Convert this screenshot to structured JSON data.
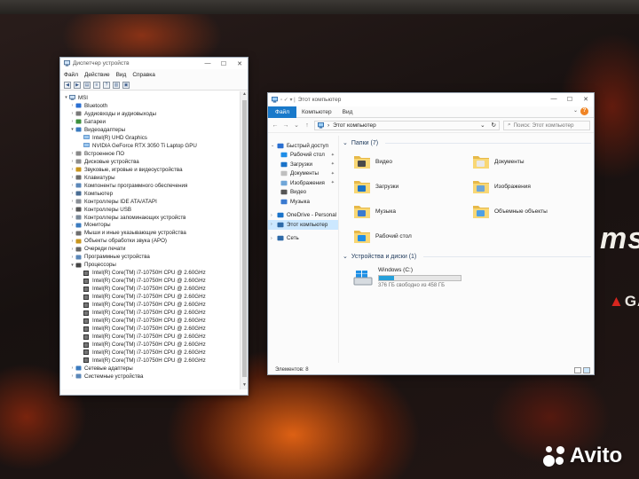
{
  "wallpaper": {
    "brand_text": "msi",
    "gaming_text": "GAM",
    "gaming_accent": "#d7261e",
    "watermark": "Avito"
  },
  "device_manager": {
    "title": "Диспетчер устройств",
    "menu": [
      "Файл",
      "Действие",
      "Вид",
      "Справка"
    ],
    "root": "MSI",
    "categories": [
      {
        "label": "Bluetooth",
        "icon": "bluetooth-icon",
        "expanded": false
      },
      {
        "label": "Аудиовходы и аудиовыходы",
        "icon": "speaker-icon",
        "expanded": false
      },
      {
        "label": "Батареи",
        "icon": "battery-icon",
        "expanded": false
      },
      {
        "label": "Видеоадаптеры",
        "icon": "display-adapter-icon",
        "expanded": true,
        "children": [
          "Intel(R) UHD Graphics",
          "NVIDIA GeForce RTX 3050 Ti Laptop GPU"
        ]
      },
      {
        "label": "Встроенное ПО",
        "icon": "firmware-icon",
        "expanded": false
      },
      {
        "label": "Дисковые устройства",
        "icon": "disk-icon",
        "expanded": false
      },
      {
        "label": "Звуковые, игровые и видеоустройства",
        "icon": "sound-icon",
        "expanded": false
      },
      {
        "label": "Клавиатуры",
        "icon": "keyboard-icon",
        "expanded": false
      },
      {
        "label": "Компоненты программного обеспечения",
        "icon": "software-icon",
        "expanded": false
      },
      {
        "label": "Компьютер",
        "icon": "computer-icon",
        "expanded": false
      },
      {
        "label": "Контроллеры IDE ATA/ATAPI",
        "icon": "ide-icon",
        "expanded": false
      },
      {
        "label": "Контроллеры USB",
        "icon": "usb-icon",
        "expanded": false
      },
      {
        "label": "Контроллеры запоминающих устройств",
        "icon": "storage-icon",
        "expanded": false
      },
      {
        "label": "Мониторы",
        "icon": "monitor-icon",
        "expanded": false
      },
      {
        "label": "Мыши и иные указывающие устройства",
        "icon": "mouse-icon",
        "expanded": false
      },
      {
        "label": "Объекты обработки звука (APO)",
        "icon": "apo-icon",
        "expanded": false
      },
      {
        "label": "Очереди печати",
        "icon": "printer-icon",
        "expanded": false
      },
      {
        "label": "Программные устройства",
        "icon": "software-device-icon",
        "expanded": false
      },
      {
        "label": "Процессоры",
        "icon": "processor-icon",
        "expanded": true,
        "children": [
          "Intel(R) Core(TM) i7-10750H CPU @ 2.60GHz",
          "Intel(R) Core(TM) i7-10750H CPU @ 2.60GHz",
          "Intel(R) Core(TM) i7-10750H CPU @ 2.60GHz",
          "Intel(R) Core(TM) i7-10750H CPU @ 2.60GHz",
          "Intel(R) Core(TM) i7-10750H CPU @ 2.60GHz",
          "Intel(R) Core(TM) i7-10750H CPU @ 2.60GHz",
          "Intel(R) Core(TM) i7-10750H CPU @ 2.60GHz",
          "Intel(R) Core(TM) i7-10750H CPU @ 2.60GHz",
          "Intel(R) Core(TM) i7-10750H CPU @ 2.60GHz",
          "Intel(R) Core(TM) i7-10750H CPU @ 2.60GHz",
          "Intel(R) Core(TM) i7-10750H CPU @ 2.60GHz",
          "Intel(R) Core(TM) i7-10750H CPU @ 2.60GHz"
        ]
      },
      {
        "label": "Сетевые адаптеры",
        "icon": "network-adapter-icon",
        "expanded": false
      },
      {
        "label": "Системные устройства",
        "icon": "system-device-icon",
        "expanded": false
      }
    ]
  },
  "explorer": {
    "title": "Этот компьютер",
    "tabs": [
      "Файл",
      "Компьютер",
      "Вид"
    ],
    "address": "Этот компьютер",
    "search_placeholder": "Поиск: Этот компьютер",
    "nav": [
      {
        "label": "Быстрый доступ",
        "icon": "star-icon",
        "pinned": false,
        "selected": false,
        "indent": 0,
        "expand": "v"
      },
      {
        "label": "Рабочий стол",
        "icon": "desktop-icon",
        "pinned": true,
        "selected": false,
        "indent": 1,
        "expand": ""
      },
      {
        "label": "Загрузки",
        "icon": "download-icon",
        "pinned": true,
        "selected": false,
        "indent": 1,
        "expand": ""
      },
      {
        "label": "Документы",
        "icon": "documents-icon",
        "pinned": true,
        "selected": false,
        "indent": 1,
        "expand": ""
      },
      {
        "label": "Изображения",
        "icon": "pictures-icon",
        "pinned": true,
        "selected": false,
        "indent": 1,
        "expand": ""
      },
      {
        "label": "Видео",
        "icon": "video-icon",
        "pinned": false,
        "selected": false,
        "indent": 1,
        "expand": ""
      },
      {
        "label": "Музыка",
        "icon": "music-icon",
        "pinned": false,
        "selected": false,
        "indent": 1,
        "expand": ""
      },
      {
        "label": "OneDrive - Personal",
        "icon": "cloud-icon",
        "pinned": false,
        "selected": false,
        "indent": 0,
        "expand": ">"
      },
      {
        "label": "Этот компьютер",
        "icon": "computer-icon",
        "pinned": false,
        "selected": true,
        "indent": 0,
        "expand": ">"
      },
      {
        "label": "Сеть",
        "icon": "network-icon",
        "pinned": false,
        "selected": false,
        "indent": 0,
        "expand": ">"
      }
    ],
    "folders_header": "Папки (7)",
    "folders": [
      {
        "label": "Видео",
        "icon": "video-folder-icon",
        "accent": "#4a4a4a"
      },
      {
        "label": "Документы",
        "icon": "documents-folder-icon",
        "accent": "#e8e8e8"
      },
      {
        "label": "Загрузки",
        "icon": "downloads-folder-icon",
        "accent": "#1a73c9"
      },
      {
        "label": "Изображения",
        "icon": "pictures-folder-icon",
        "accent": "#6fa6d8"
      },
      {
        "label": "Музыка",
        "icon": "music-folder-icon",
        "accent": "#3a7ad0"
      },
      {
        "label": "Объемные объекты",
        "icon": "3d-objects-folder-icon",
        "accent": "#4ea0e4"
      },
      {
        "label": "Рабочий стол",
        "icon": "desktop-folder-icon",
        "accent": "#1f8ee8"
      }
    ],
    "drives_header": "Устройства и диски (1)",
    "drive": {
      "name": "Windows (C:)",
      "free_text": "376 ГБ свободно из 458 ГБ",
      "used_fraction": 0.18
    },
    "status": "Элементов: 8"
  }
}
